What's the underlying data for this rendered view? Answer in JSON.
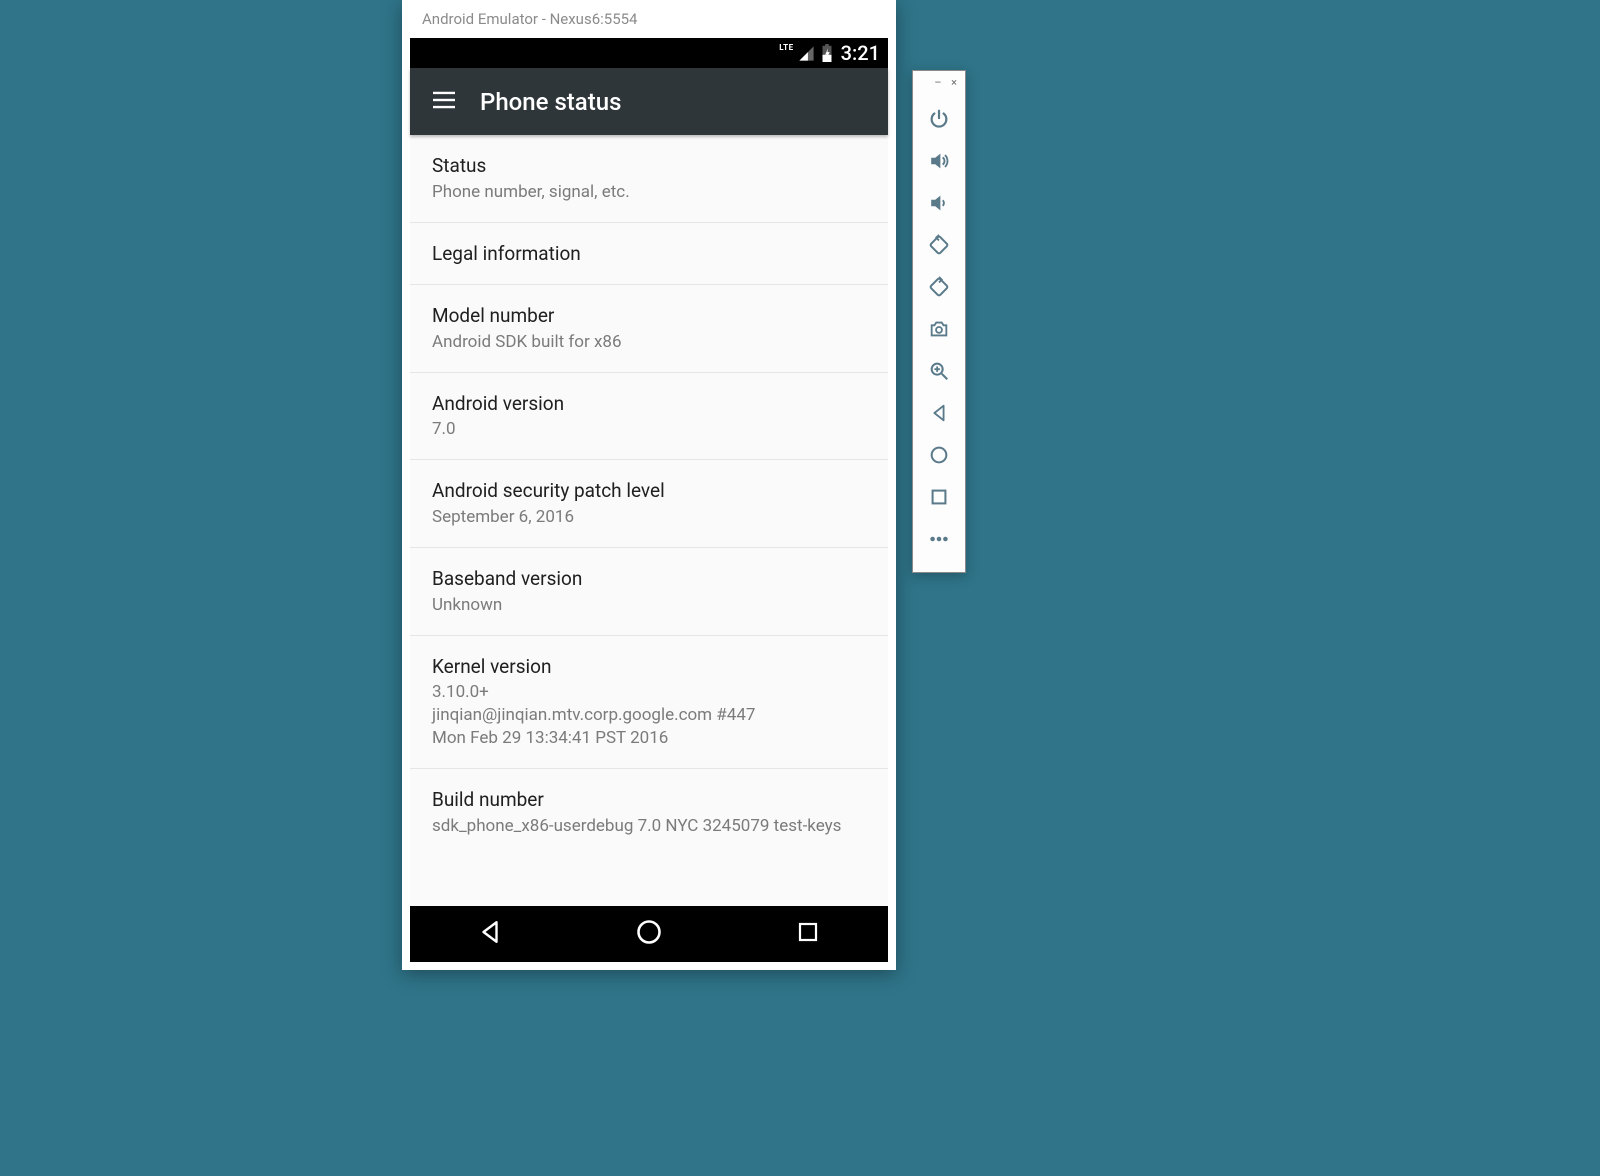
{
  "window": {
    "title": "Android Emulator - Nexus6:5554"
  },
  "statusbar": {
    "network_label": "LTE",
    "time": "3:21"
  },
  "appbar": {
    "title": "Phone status"
  },
  "settings": [
    {
      "title": "Status",
      "sub": "Phone number, signal, etc."
    },
    {
      "title": "Legal information",
      "sub": ""
    },
    {
      "title": "Model number",
      "sub": "Android SDK built for x86"
    },
    {
      "title": "Android version",
      "sub": "7.0"
    },
    {
      "title": "Android security patch level",
      "sub": "September 6, 2016"
    },
    {
      "title": "Baseband version",
      "sub": "Unknown"
    },
    {
      "title": "Kernel version",
      "sub": "3.10.0+\njinqian@jinqian.mtv.corp.google.com #447\nMon Feb 29 13:34:41 PST 2016"
    },
    {
      "title": "Build number",
      "sub": "sdk_phone_x86-userdebug 7.0 NYC 3245079 test-keys"
    }
  ],
  "toolbar": {
    "icons": [
      "power-icon",
      "volume-up-icon",
      "volume-down-icon",
      "rotate-left-icon",
      "rotate-right-icon",
      "camera-icon",
      "zoom-icon",
      "back-icon",
      "home-icon",
      "overview-icon",
      "more-icon"
    ]
  }
}
